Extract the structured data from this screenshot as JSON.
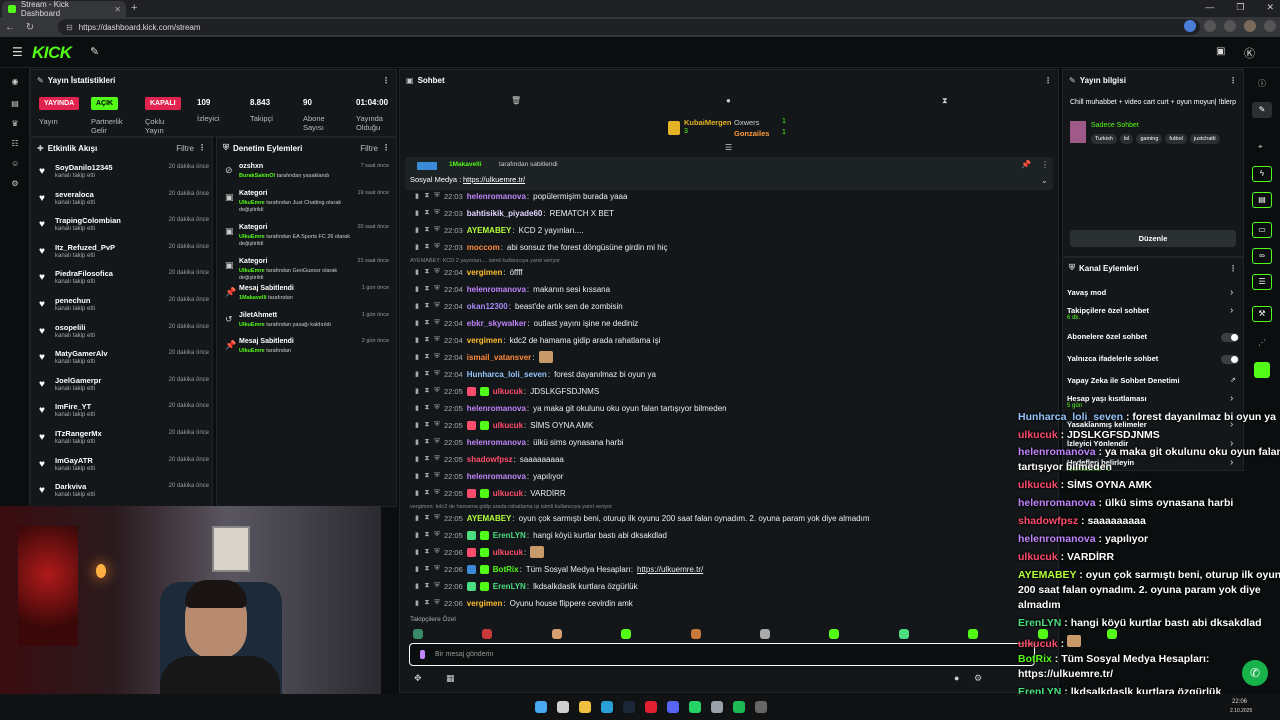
{
  "browser": {
    "tab_title": "Stream - Kick Dashboard",
    "url": "https://dashboard.kick.com/stream",
    "win_controls": [
      "—",
      "❐",
      "✕"
    ]
  },
  "header": {
    "logo": "KICK"
  },
  "stats_panel": {
    "title": "Yayın İstatistikleri",
    "pills": [
      {
        "label": "YAYINDA",
        "sub": "Yayın",
        "color": "#e0244f"
      },
      {
        "label": "AÇIK",
        "sub": "Partnerlik Gelir",
        "color": "#53fc18"
      },
      {
        "label": "KAPALI",
        "sub": "Çoklu Yayın",
        "color": "#e0244f"
      }
    ],
    "stats": [
      {
        "value": "109",
        "label": "İzleyici"
      },
      {
        "value": "8.843",
        "label": "Takipçi"
      },
      {
        "value": "90",
        "label": "Abone Sayısı"
      },
      {
        "value": "01:04:00",
        "label": "Yayında Olduğu"
      }
    ]
  },
  "activity": {
    "title": "Etkinlik Akışı",
    "filter": "Filtre",
    "sub": "kanalı takip etti",
    "time": "20 dakika önce",
    "items": [
      "SoyDanilo12345",
      "severaloca",
      "TrapingColombian",
      "Itz_Refuzed_PvP",
      "PiedraFilosofica",
      "penechun",
      "osopelili",
      "MatyGamerAlv",
      "JoelGamerpr",
      "ImFire_YT",
      "ITzRangerMx",
      "ImGayATR",
      "Darkviva"
    ]
  },
  "moderation": {
    "title": "Denetim Eylemleri",
    "filter": "Filtre",
    "items": [
      {
        "icon": "ban-icon",
        "title": "ozshxn",
        "desc_user": "BurakSakinOl",
        "desc": "tarafından yasaklandı",
        "time": "7 saat önce"
      },
      {
        "icon": "category-icon",
        "title": "Kategori",
        "desc_user": "UlkuEmre",
        "desc": "tarafından Just Chatting olarak değiştirildi",
        "time": "19 saat önce"
      },
      {
        "icon": "category-icon",
        "title": "Kategori",
        "desc_user": "UlkuEmre",
        "desc": "tarafından EA Sports FC 26 olarak değiştirildi",
        "time": "20 saat önce"
      },
      {
        "icon": "category-icon",
        "title": "Kategori",
        "desc_user": "UlkuEmre",
        "desc": "tarafından GeoGuessr olarak değiştirildi",
        "time": "21 saat önce"
      },
      {
        "icon": "pin-icon",
        "title": "Mesaj Sabitlendi",
        "desc_user": "1Makavelli",
        "desc": "tarafından",
        "time": "1 gün önce"
      },
      {
        "icon": "unban-icon",
        "title": "JiletAhmett",
        "desc_user": "UlkuEmre",
        "desc": "tarafından yasağı kaldırıldı",
        "time": "1 gün önce"
      },
      {
        "icon": "pin-icon",
        "title": "Mesaj Sabitlendi",
        "desc_user": "UlkuEmre",
        "desc": "tarafından",
        "time": "2 gün önce"
      }
    ]
  },
  "chat": {
    "title": "Sohbet",
    "top_gifters": [
      {
        "name": "KubaiMergen",
        "count": "3"
      },
      {
        "name": "Oxwers",
        "count": "1"
      },
      {
        "name": "Gonzailes",
        "count": "1"
      }
    ],
    "pinned": {
      "by": "1Makavelli",
      "by_suffix": "tarafından sabitlendi",
      "label": "Sosyal Medya :",
      "link": "https://ulkuemre.tr/"
    },
    "messages": [
      {
        "ts": "22:03",
        "user": "helenromanova",
        "color": "#c084fc",
        "msg": "popülermişim burada yaaa"
      },
      {
        "ts": "22:03",
        "user": "bahtisikik_piyade60",
        "color": "#e2d5ff",
        "msg": "REMATCH X BET"
      },
      {
        "ts": "22:03",
        "user": "AYEMABEY",
        "color": "#b5ff3b",
        "msg": "KCD 2 yayınları...."
      },
      {
        "ts": "22:03",
        "user": "moccom",
        "color": "#ff8a3d",
        "msg": "abi sonsuz the forest döngüsüne girdin mi hiç"
      },
      {
        "ts": "22:04",
        "user": "vergimen",
        "color": "#ffbd2e",
        "msg": "öffff"
      },
      {
        "ts": "22:04",
        "user": "helenromanova",
        "color": "#c084fc",
        "msg": "makanın sesi kıssana"
      },
      {
        "ts": "22:04",
        "user": "okan12300",
        "color": "#a78bfa",
        "msg": "beast'de artık sen de zombisin"
      },
      {
        "ts": "22:04",
        "user": "ebkr_skywalker",
        "color": "#c084fc",
        "msg": "outlast yayını işine ne dediniz"
      },
      {
        "ts": "22:04",
        "user": "vergimen",
        "color": "#ffbd2e",
        "msg": "kdc2 de hamama gidip arada rahatlama işi"
      },
      {
        "ts": "22:04",
        "user": "ismail_vatansver",
        "color": "#ff8a3d",
        "msg": ""
      },
      {
        "ts": "22:04",
        "user": "Hunharca_loli_seven",
        "color": "#93c5fd",
        "msg": "forest dayanılmaz bi oyun ya"
      },
      {
        "ts": "22:05",
        "user": "ulkucuk",
        "color": "#ff4d6d",
        "msg": "JDSLKGFSDJNMS"
      },
      {
        "ts": "22:05",
        "user": "helenromanova",
        "color": "#c084fc",
        "msg": "ya maka git okulunu oku oyun falan tartışıyor bilmeden"
      },
      {
        "ts": "22:05",
        "user": "ulkucuk",
        "color": "#ff4d6d",
        "msg": "SİMS OYNA AMK"
      },
      {
        "ts": "22:05",
        "user": "helenromanova",
        "color": "#c084fc",
        "msg": "ülkü sims oynasana harbi"
      },
      {
        "ts": "22:05",
        "user": "shadowfpsz",
        "color": "#ff4d6d",
        "msg": "saaaaaaaaa"
      },
      {
        "ts": "22:05",
        "user": "helenromanova",
        "color": "#c084fc",
        "msg": "yapılıyor"
      },
      {
        "ts": "22:05",
        "user": "ulkucuk",
        "color": "#ff4d6d",
        "msg": "VARDİRR"
      },
      {
        "ts": "22:05",
        "user": "AYEMABEY",
        "color": "#b5ff3b",
        "msg": "oyun çok sarmıştı beni, oturup ilk oyunu 200 saat falan oynadım. 2. oyuna param yok diye almadım"
      },
      {
        "ts": "22:05",
        "user": "ErenLYN",
        "color": "#4ade80",
        "msg": "hangi köyü kurtlar bastı abi dksakdlad"
      },
      {
        "ts": "22:06",
        "user": "ulkucuk",
        "color": "#ff4d6d",
        "msg": ""
      },
      {
        "ts": "22:06",
        "user": "BotRix",
        "color": "#53fc18",
        "msg": "Tüm Sosyal Medya Hesapları:",
        "link": "https://ulkuemre.tr/"
      },
      {
        "ts": "22:06",
        "user": "ErenLYN",
        "color": "#4ade80",
        "msg": "lkdsalkdaslk kurtlara özgürlük"
      },
      {
        "ts": "22:06",
        "user": "vergimen",
        "color": "#ffbd2e",
        "msg": "Oyunu house flippere cevirdin amk"
      }
    ],
    "reply_1": "AYEMABEY: KCD 2 yayınları.... isimli kullanıcıya yanıt veriyor",
    "reply_2": "vergimen: kdc2 de hamama gidip arada rahatlama işi isimli kullanıcıya yanıt veriyor",
    "followers_only": "Takipçilere Özel",
    "input_placeholder": "Bir mesaj gönderin"
  },
  "stream_info": {
    "title": "Yayın bilgisi",
    "stream_title": "Chill muhabbet + video cart curt + oyun moyun| !blerp",
    "category": "Sadece Sohbet",
    "tags": [
      "Turkish",
      "lol",
      "gaming",
      "futbol",
      "justchatti"
    ],
    "edit_button": "Düzenle"
  },
  "channel_actions": {
    "title": "Kanal Eylemleri",
    "items": [
      {
        "label": "Yavaş mod",
        "sub": "",
        "control": "chevron"
      },
      {
        "label": "Takipçilere özel sohbet",
        "sub": "6 dk.",
        "control": "chevron"
      },
      {
        "label": "Abonelere özel sohbet",
        "sub": "",
        "control": "toggle"
      },
      {
        "label": "Yalnızca ifadelerle sohbet",
        "sub": "",
        "control": "toggle"
      },
      {
        "label": "Yapay Zeka ile Sohbet Denetimi",
        "sub": "",
        "control": "external"
      },
      {
        "label": "Hesap yaşı kısıtlaması",
        "sub": "5 gün",
        "control": "chevron"
      },
      {
        "label": "Yasaklanmış kelimeler",
        "sub": "",
        "control": "chevron"
      },
      {
        "label": "İzleyici Yönlendir",
        "sub": "",
        "control": "chevron"
      },
      {
        "label": "Hedefleri belirleyin",
        "sub": "Aktif hedefler - 2",
        "control": "chevron"
      }
    ]
  },
  "overlay_chat": [
    {
      "user": "Hunharca_loli_seven",
      "color": "#93c5fd",
      "msg": "forest dayanılmaz bi oyun ya"
    },
    {
      "user": "ulkucuk",
      "color": "#ff4d6d",
      "msg": "JDSLKGFSDJNMS"
    },
    {
      "user": "helenromanova",
      "color": "#c084fc",
      "msg": "ya maka git okulunu oku oyun falan"
    },
    {
      "user": "",
      "color": "#fff",
      "msg": "tartışıyor bilmeden"
    },
    {
      "user": "ulkucuk",
      "color": "#ff4d6d",
      "msg": "SİMS OYNA AMK"
    },
    {
      "user": "helenromanova",
      "color": "#c084fc",
      "msg": "ülkü sims oynasana harbi"
    },
    {
      "user": "shadowfpsz",
      "color": "#ff4d6d",
      "msg": "saaaaaaaaa"
    },
    {
      "user": "helenromanova",
      "color": "#c084fc",
      "msg": "yapılıyor"
    },
    {
      "user": "ulkucuk",
      "color": "#ff4d6d",
      "msg": "VARDİRR"
    },
    {
      "user": "AYEMABEY",
      "color": "#b5ff3b",
      "msg": "oyun çok sarmıştı beni, oturup ilk oyunu"
    },
    {
      "user": "",
      "color": "#fff",
      "msg": "200 saat falan oynadım. 2. oyuna param yok diye"
    },
    {
      "user": "",
      "color": "#fff",
      "msg": "almadım"
    },
    {
      "user": "ErenLYN",
      "color": "#4ade80",
      "msg": "hangi köyü kurtlar bastı abi dksakdlad"
    },
    {
      "user": "ulkucuk",
      "color": "#ff4d6d",
      "msg": ""
    },
    {
      "user": "BotRix",
      "color": "#53fc18",
      "msg": "Tüm Sosyal Medya Hesapları:"
    },
    {
      "user": "",
      "color": "#fff",
      "msg": "https://ulkuemre.tr/"
    },
    {
      "user": "ErenLYN",
      "color": "#4ade80",
      "msg": "lkdsalkdaslk kurtlara özgürlük"
    },
    {
      "user": "vergimen",
      "color": "#ffbd2e",
      "msg": "Oyunu house flippere cevirdin amk"
    }
  ],
  "clock": {
    "time": "22:06",
    "date": "2.10.2025"
  }
}
